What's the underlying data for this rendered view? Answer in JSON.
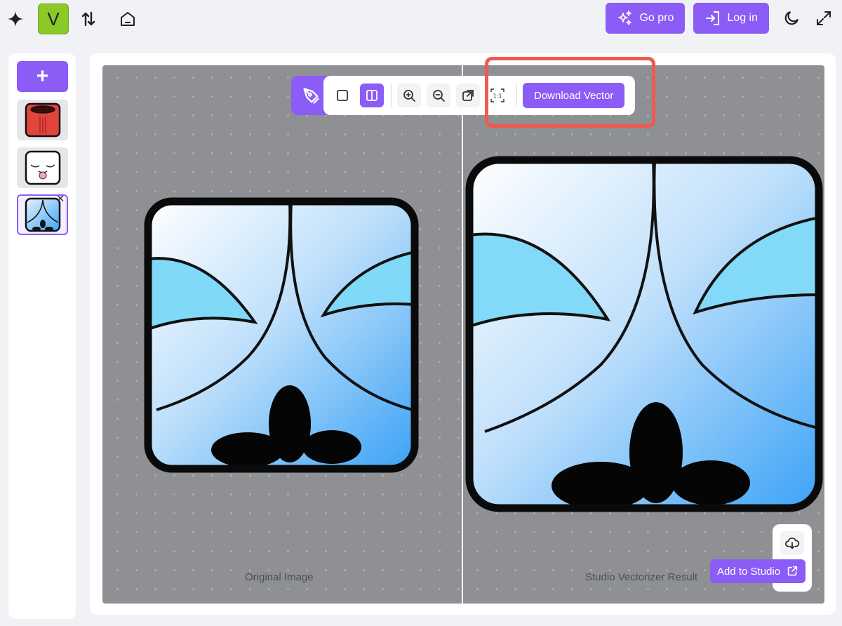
{
  "header": {
    "logo_letter": "V",
    "go_pro_label": "Go pro",
    "login_label": "Log in",
    "icons": [
      "sparkle-icon",
      "sort-arrows-icon",
      "home-icon",
      "moon-icon",
      "expand-icon"
    ]
  },
  "sidebar": {
    "add_label": "+",
    "items": [
      {
        "name": "red-cup-image"
      },
      {
        "name": "tongue-face-image"
      },
      {
        "name": "blue-face-image",
        "active": true
      }
    ],
    "remove_label": "✕"
  },
  "toolbar": {
    "download_label": "Download Vector",
    "tools": [
      "pen-icon",
      "single-view-icon",
      "split-view-icon",
      "zoom-in-icon",
      "zoom-out-icon",
      "fit-icon",
      "actual-size-icon"
    ]
  },
  "canvas": {
    "left_caption": "Original Image",
    "right_caption": "Studio Vectorizer Result"
  },
  "actions": {
    "add_to_studio_label": "Add to Studio"
  },
  "colors": {
    "accent": "#8b5cf6",
    "logo": "#8ac926",
    "highlight": "#ef5a50"
  }
}
